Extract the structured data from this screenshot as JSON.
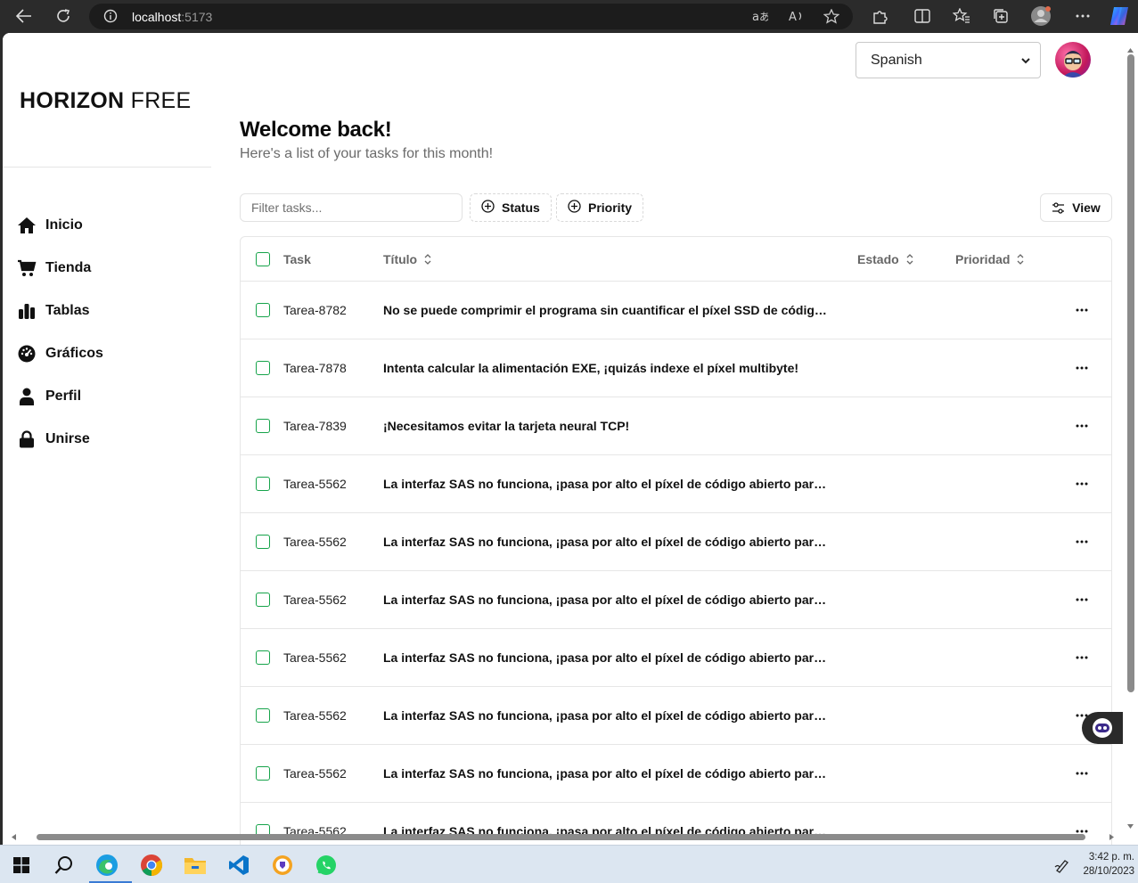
{
  "browser": {
    "url_host": "localhost",
    "url_port": ":5173"
  },
  "sidebar": {
    "brand_bold": "HORIZON",
    "brand_light": "FREE",
    "items": [
      {
        "label": "Inicio",
        "icon": "home-icon"
      },
      {
        "label": "Tienda",
        "icon": "cart-icon"
      },
      {
        "label": "Tablas",
        "icon": "bar-chart-icon"
      },
      {
        "label": "Gráficos",
        "icon": "gauge-icon"
      },
      {
        "label": "Perfil",
        "icon": "person-icon"
      },
      {
        "label": "Unirse",
        "icon": "lock-icon"
      }
    ]
  },
  "header": {
    "language_selected": "Spanish",
    "title": "Welcome back!",
    "subtitle": "Here's a list of your tasks for this month!"
  },
  "toolbar": {
    "filter_placeholder": "Filter tasks...",
    "status_label": "Status",
    "priority_label": "Priority",
    "view_label": "View"
  },
  "table": {
    "columns": {
      "task": "Task",
      "title": "Título",
      "status": "Estado",
      "priority": "Prioridad"
    },
    "rows": [
      {
        "id": "Tarea-8782",
        "title": "No se puede comprimir el programa sin cuantificar el píxel SSD de código ab..."
      },
      {
        "id": "Tarea-7878",
        "title": "Intenta calcular la alimentación EXE, ¡quizás indexe el píxel multibyte!"
      },
      {
        "id": "Tarea-7839",
        "title": "¡Necesitamos evitar la tarjeta neural TCP!"
      },
      {
        "id": "Tarea-5562",
        "title": "La interfaz SAS no funciona, ¡pasa por alto el píxel de código abierto para qu..."
      },
      {
        "id": "Tarea-5562",
        "title": "La interfaz SAS no funciona, ¡pasa por alto el píxel de código abierto para qu..."
      },
      {
        "id": "Tarea-5562",
        "title": "La interfaz SAS no funciona, ¡pasa por alto el píxel de código abierto para qu..."
      },
      {
        "id": "Tarea-5562",
        "title": "La interfaz SAS no funciona, ¡pasa por alto el píxel de código abierto para qu..."
      },
      {
        "id": "Tarea-5562",
        "title": "La interfaz SAS no funciona, ¡pasa por alto el píxel de código abierto para qu..."
      },
      {
        "id": "Tarea-5562",
        "title": "La interfaz SAS no funciona, ¡pasa por alto el píxel de código abierto para qu..."
      },
      {
        "id": "Tarea-5562",
        "title": "La interfaz SAS no funciona, ¡pasa por alto el píxel de código abierto para qu..."
      }
    ]
  },
  "taskbar": {
    "time": "3:42 p. m.",
    "date": "28/10/2023"
  },
  "colors": {
    "accent_checkbox": "#16a34a",
    "browser_frame": "#2b2b2b",
    "taskbar": "#dce6f1"
  }
}
